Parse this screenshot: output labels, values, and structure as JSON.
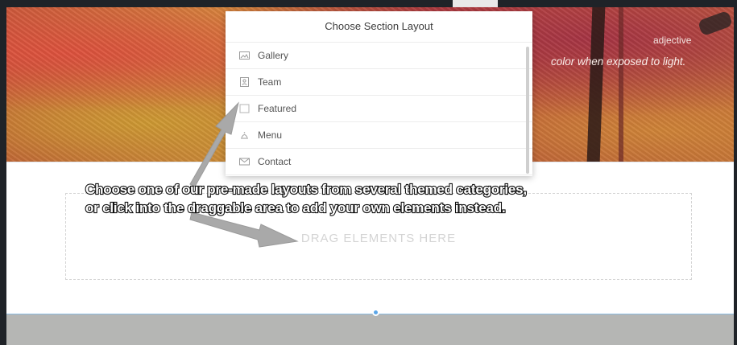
{
  "hero": {
    "tag": "adjective",
    "sentence": "color when exposed to light."
  },
  "layout_menu": {
    "title": "Choose Section Layout",
    "items": [
      {
        "label": "Gallery",
        "icon": "gallery-icon"
      },
      {
        "label": "Team",
        "icon": "team-icon"
      },
      {
        "label": "Featured",
        "icon": "featured-icon"
      },
      {
        "label": "Menu",
        "icon": "menu-icon"
      },
      {
        "label": "Contact",
        "icon": "contact-icon"
      }
    ]
  },
  "drop_zone": {
    "label": "DRAG ELEMENTS HERE"
  },
  "callout": {
    "line1": "Choose one of our pre-made layouts from several themed categories,",
    "line2": "or click into the draggable area to add your own elements instead."
  },
  "colors": {
    "accent": "#5aa6e8",
    "band": "#b5b6b4",
    "arrow": "#a9a9a9"
  }
}
